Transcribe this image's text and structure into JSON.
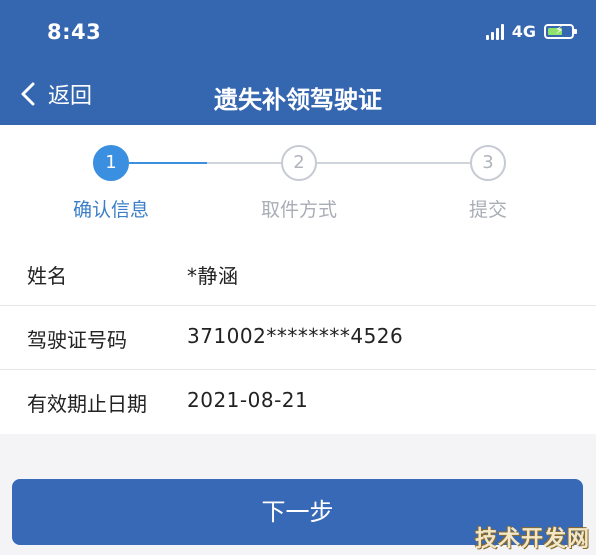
{
  "status_bar": {
    "time": "8:43",
    "network": "4G",
    "battery_icon": "battery-charging-icon",
    "signal_icon": "signal-icon"
  },
  "nav": {
    "back_label": "返回",
    "title": "遗失补领驾驶证",
    "back_icon": "chevron-left-icon"
  },
  "steps": [
    {
      "number": "1",
      "label": "确认信息",
      "state": "active"
    },
    {
      "number": "2",
      "label": "取件方式",
      "state": "inactive"
    },
    {
      "number": "3",
      "label": "提交",
      "state": "inactive"
    }
  ],
  "info_rows": [
    {
      "label": "姓名",
      "value": "*静涵"
    },
    {
      "label": "驾驶证号码",
      "value": "371002********4526"
    },
    {
      "label": "有效期止日期",
      "value": "2021-08-21"
    }
  ],
  "next_button_label": "下一步",
  "watermark": "技术开发网",
  "colors": {
    "header": "#3566b0",
    "accent": "#3a8fe0",
    "button": "#3869b7",
    "inactive": "#c6cad2"
  }
}
